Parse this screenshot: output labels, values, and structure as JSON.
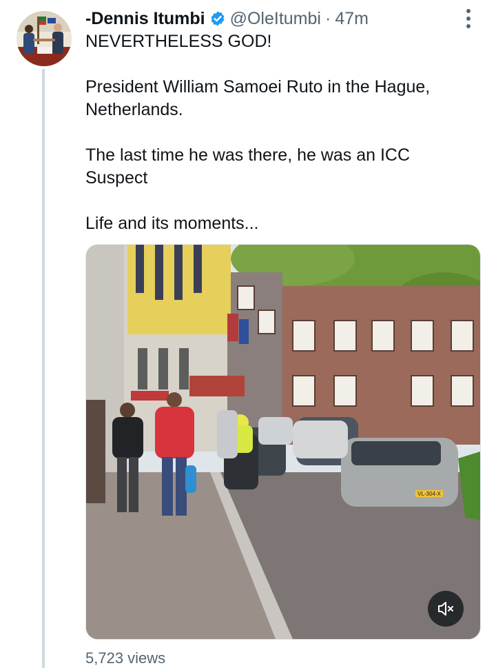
{
  "author": {
    "display_name": "-Dennis Itumbi",
    "handle": "@OleItumbi",
    "separator": "·",
    "time": "47m"
  },
  "tweet": {
    "lines": [
      "NEVERTHELESS GOD!",
      "",
      "President William Samoei Ruto in the Hague,",
      "Netherlands.",
      "",
      "The last time he was there, he was an ICC",
      "Suspect",
      "",
      "Life and its moments..."
    ]
  },
  "media": {
    "type": "video",
    "mute_icon": "speaker-muted-icon",
    "plate_text": "VL-304-X"
  },
  "stats": {
    "views": "5,723 views"
  },
  "colors": {
    "verified": "#1d9bf0",
    "secondary_text": "#536471",
    "thread_line": "#cfd9de"
  }
}
